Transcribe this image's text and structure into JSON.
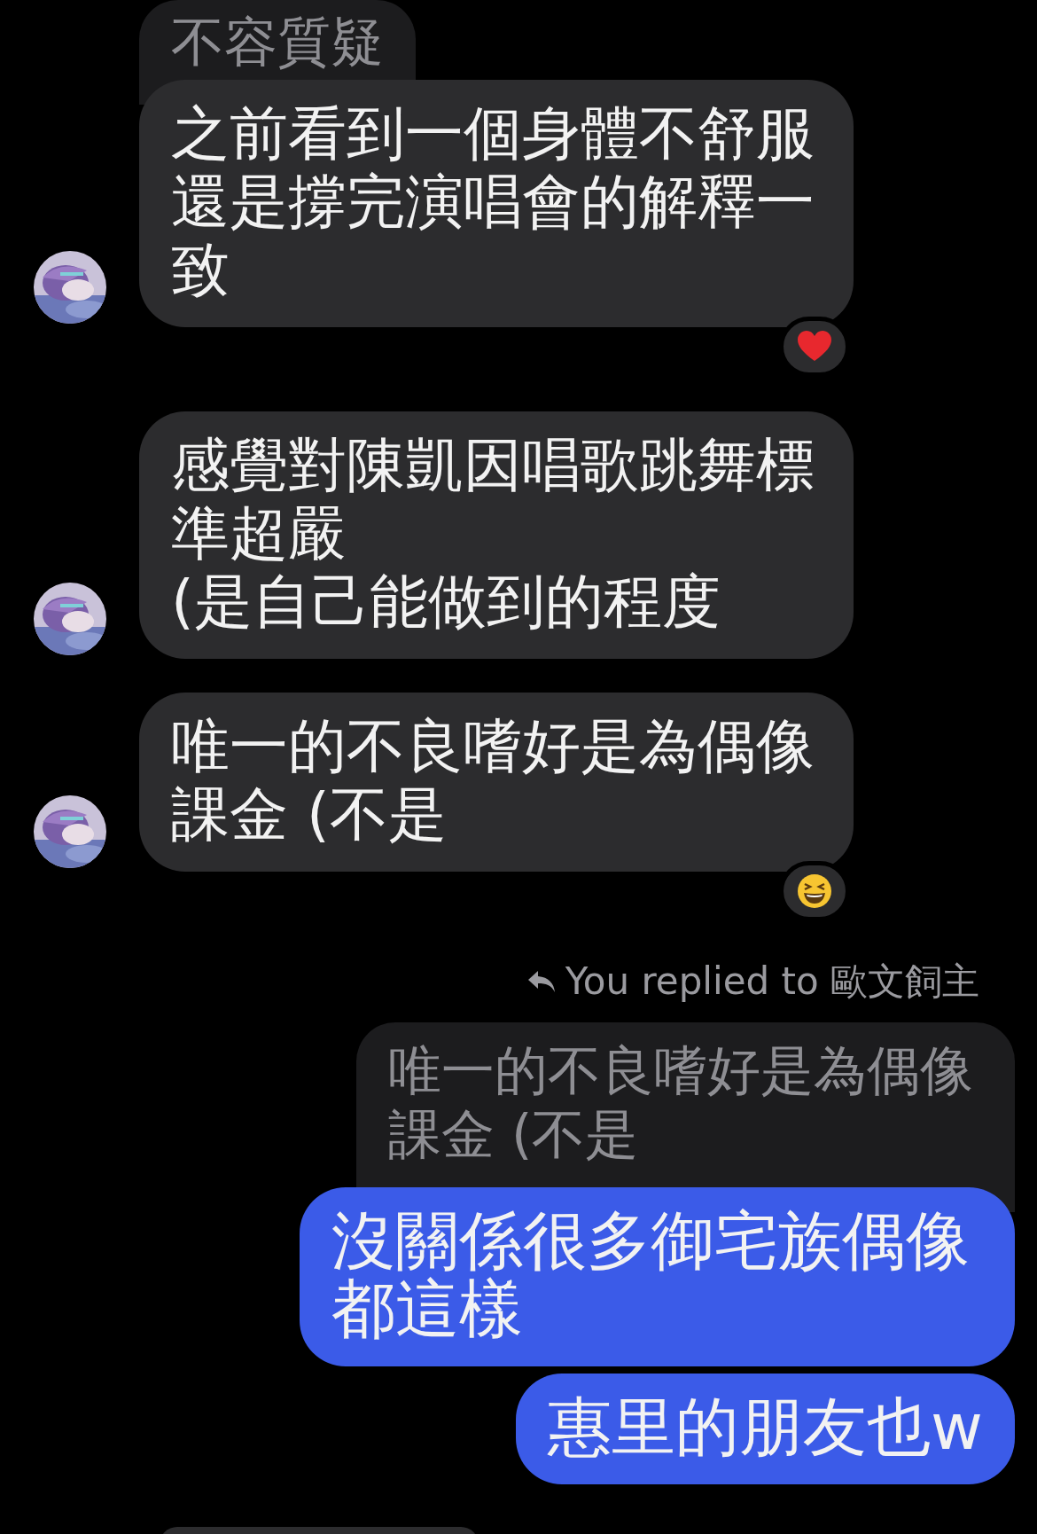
{
  "messages": [
    {
      "kind": "received",
      "quote": "不容質疑",
      "text": "之前看到一個身體不舒服還是撐完演唱會的解釋一致",
      "reaction": {
        "kind": "heart"
      }
    },
    {
      "kind": "received",
      "text": "感覺對陳凱因唱歌跳舞標準超嚴\n(是自己能做到的程度"
    },
    {
      "kind": "received",
      "text": "唯一的不良嗜好是為偶像課金 (不是",
      "reaction": {
        "kind": "laugh"
      }
    },
    {
      "kind": "sent",
      "reply_label": "You replied to 歐文飼主",
      "quote": "唯一的不良嗜好是為偶像課金 (不是",
      "text": "沒關係很多御宅族偶像都這樣"
    },
    {
      "kind": "sent",
      "text": "惠里的朋友也w"
    }
  ]
}
